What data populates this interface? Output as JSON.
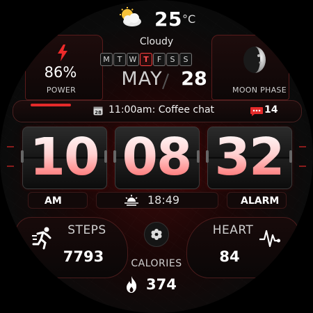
{
  "weather": {
    "temperature": "25",
    "unit": "°C",
    "condition": "Cloudy",
    "icon": "cloud-sun-icon"
  },
  "power": {
    "value": "86%",
    "label": "POWER",
    "icon": "bolt-icon"
  },
  "moon": {
    "label": "MOON PHASE",
    "icon": "moon-icon"
  },
  "week": {
    "days": [
      "M",
      "T",
      "W",
      "T",
      "F",
      "S",
      "S"
    ],
    "active_index": 3
  },
  "date": {
    "month": "MAY",
    "day": "28"
  },
  "event": {
    "text": "11:00am: Coffee chat",
    "calendar_day": "28",
    "message_count": "14",
    "progress": 0.14
  },
  "time": {
    "hour": "10",
    "minute": "08",
    "second": "32",
    "ampm": "AM"
  },
  "sunset": {
    "time": "18:49",
    "icon": "sunset-icon"
  },
  "alarm": {
    "label": "ALARM"
  },
  "steps": {
    "label": "STEPS",
    "value": "7793",
    "icon": "running-icon"
  },
  "heart": {
    "label": "HEART",
    "value": "84",
    "icon": "pulse-icon"
  },
  "calories": {
    "label": "CALORIES",
    "value": "374",
    "icon": "flame-icon"
  },
  "colors": {
    "accent": "#e42a2a",
    "background": "#0b0b0b",
    "digit_bottom": "#ff5a5a"
  }
}
